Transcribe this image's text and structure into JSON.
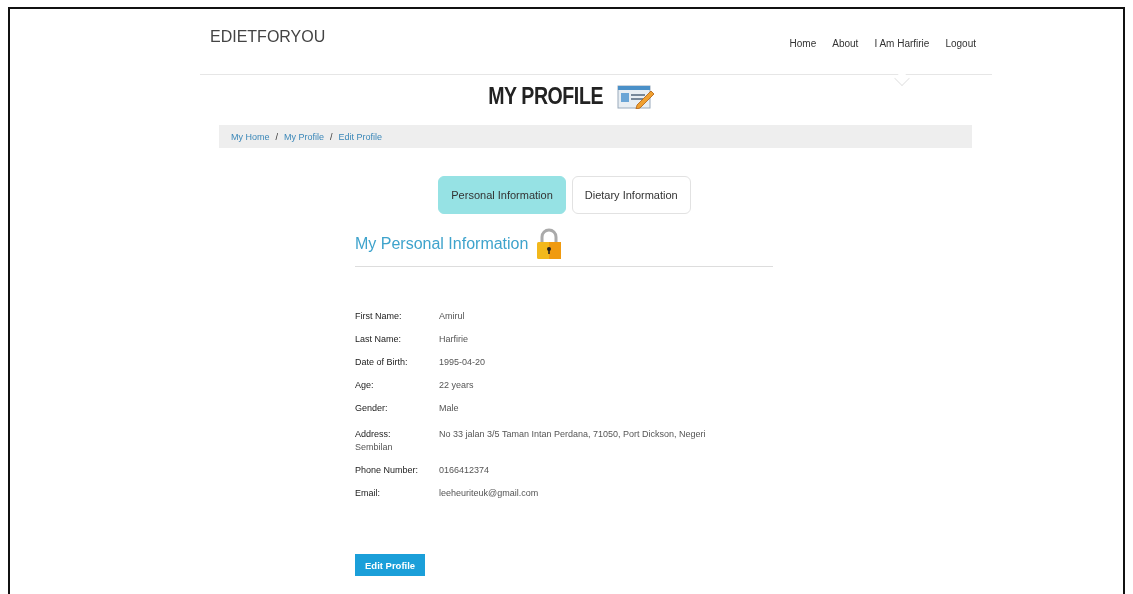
{
  "brand": "EDIETFORYOU",
  "nav": [
    {
      "label": "Home",
      "selected": false
    },
    {
      "label": "About",
      "selected": false
    },
    {
      "label": "I Am Harfirie",
      "selected": true
    },
    {
      "label": "Logout",
      "selected": false
    }
  ],
  "page_title": "MY PROFILE",
  "breadcrumb": [
    {
      "label": "My Home"
    },
    {
      "separator": "/",
      "label": "My Profile"
    },
    {
      "separator": "/",
      "label": "Edit Profile"
    }
  ],
  "tabs": [
    {
      "label": "Personal Information",
      "selected": true
    },
    {
      "label": "Dietary Information",
      "selected": false
    }
  ],
  "section_title": "My Personal Information",
  "info_groups": [
    [
      {
        "label": "First Name:",
        "value": "Amirul"
      },
      {
        "label": "Last Name:",
        "value": "Harfirie"
      },
      {
        "label": "Date of Birth:",
        "value": "1995-04-20"
      },
      {
        "label": "Age:",
        "value": "22 years"
      },
      {
        "label": "Gender:",
        "value": "Male"
      }
    ],
    [
      {
        "label": "Address:",
        "value": "No 33 jalan 3/5 Taman Intan Perdana, 71050, Port Dickson, Negeri",
        "continuation": "Sembilan"
      },
      {
        "label": "Phone Number:",
        "value": "0166412374"
      },
      {
        "label": "Email:",
        "value": "leeheuriteuk@gmail.com"
      }
    ]
  ],
  "edit_button": "Edit Profile"
}
